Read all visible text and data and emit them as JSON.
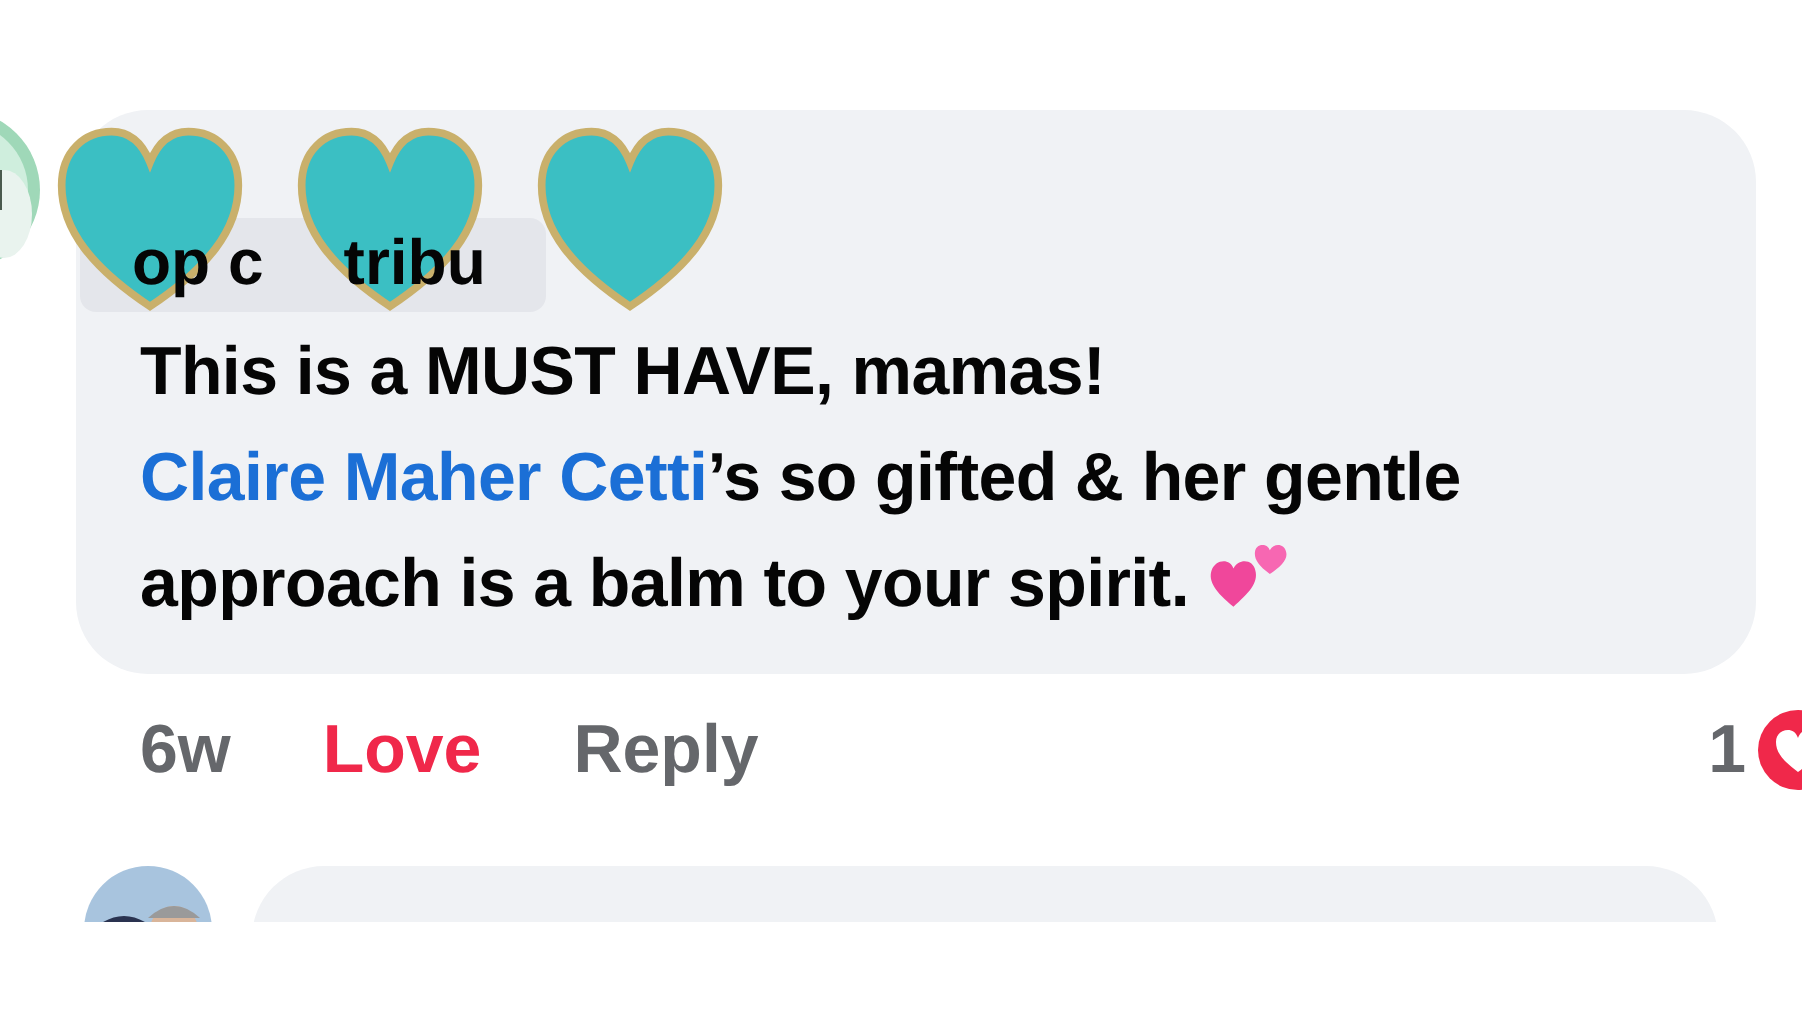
{
  "comments": [
    {
      "badge_fragments": [
        "op c",
        "tribu"
      ],
      "text_before": "This is a MUST HAVE, mamas! ",
      "mention": "Claire Maher Cetti",
      "text_after": "’s so gifted & her gentle approach is a balm to your spirit.",
      "time": "6w",
      "love": {
        "label": "Love",
        "selected": true
      },
      "reply": "Reply",
      "reaction_count": "1"
    }
  ]
}
